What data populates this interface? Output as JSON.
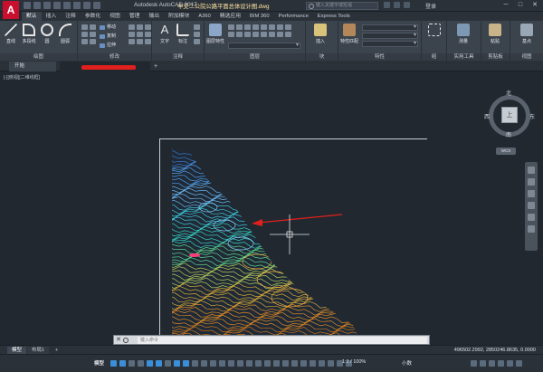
{
  "app": {
    "logo": "A",
    "title_app": "Autodesk AutoCAD 2017",
    "title_file": "中交二公院公路平面总体设计图.dwg",
    "search_placeholder": "键入关键字或短语",
    "user": "登录",
    "window_controls": [
      "─",
      "□",
      "✕"
    ]
  },
  "ribbon": {
    "tabs": [
      "默认",
      "插入",
      "注释",
      "参数化",
      "视图",
      "管理",
      "输出",
      "附加模块",
      "A360",
      "精选应用",
      "BIM 360",
      "Performance",
      "Express Tools"
    ],
    "active_tab": 0,
    "groups": {
      "draw": {
        "title": "绘图",
        "tools": [
          "直线",
          "多段线",
          "圆",
          "圆弧"
        ]
      },
      "modify": {
        "title": "修改",
        "tools": [
          "移动",
          "复制",
          "拉伸"
        ]
      },
      "annotation": {
        "title": "注释",
        "tools": [
          "文字",
          "标注"
        ]
      },
      "layers": {
        "title": "图层",
        "tools": [
          "图层特性"
        ]
      },
      "block": {
        "title": "块",
        "tools": [
          "插入"
        ]
      },
      "properties": {
        "title": "特性",
        "tools": [
          "特性匹配"
        ]
      },
      "groups_panel": {
        "title": "组",
        "tools": [
          "组"
        ]
      },
      "utilities": {
        "title": "实用工具",
        "tools": [
          "测量"
        ]
      },
      "clipboard": {
        "title": "剪贴板",
        "tools": [
          "粘贴"
        ]
      },
      "view": {
        "title": "视图",
        "tools": [
          "基点"
        ]
      }
    }
  },
  "doc_tabs": {
    "start": "开始"
  },
  "canvas": {
    "view_label": "[-][俯视][二维线框]",
    "viewcube": {
      "north": "北",
      "south": "南",
      "west": "西",
      "east": "东",
      "face": "上"
    },
    "wcs": "WCS"
  },
  "command_line": {
    "placeholder": "键入命令"
  },
  "layout_tabs": [
    "模型",
    "布局1",
    "+"
  ],
  "coordinates": "496502.2992, 2850246.8635, 0.0000",
  "status_bar": {
    "model": "模型",
    "scale": "1:1 / 100%",
    "unit": "小数"
  },
  "colors": {
    "background": "#212830",
    "ribbon": "#3b434d",
    "accent": "#c8102e",
    "annotation_arrow": "#e0201c"
  }
}
